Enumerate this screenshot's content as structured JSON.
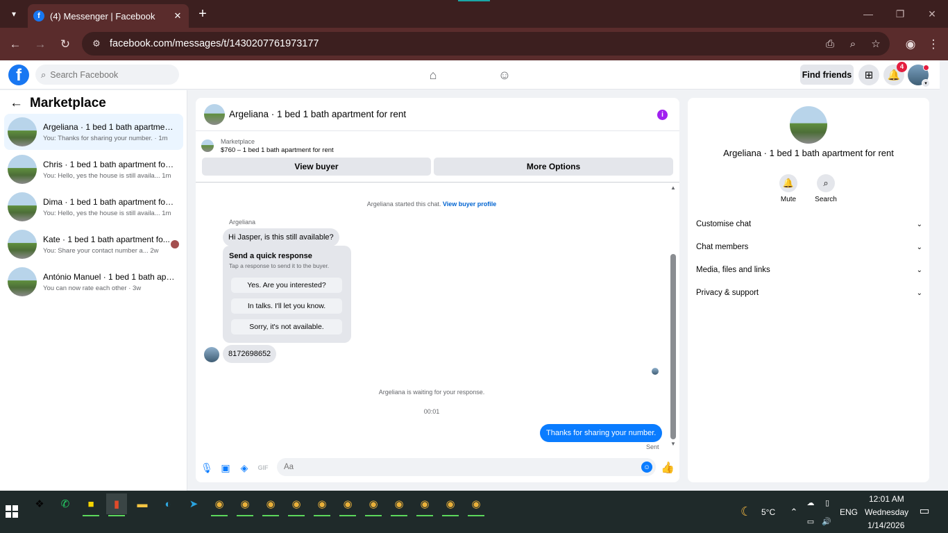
{
  "browser": {
    "tab_title": "(4) Messenger | Facebook",
    "url": "facebook.com/messages/t/1430207761973177"
  },
  "fb_header": {
    "search_placeholder": "Search Facebook",
    "find_friends": "Find friends",
    "notification_count": "4"
  },
  "sidebar": {
    "title": "Marketplace",
    "conversations": [
      {
        "name": "Argeliana · 1 bed 1 bath apartment...",
        "snippet": "You: Thanks for sharing your number. · 1m"
      },
      {
        "name": "Chris · 1 bed 1 bath apartment for ...",
        "snippet": "You: Hello, yes the house is still availa... 1m"
      },
      {
        "name": "Dima · 1 bed 1 bath apartment for ...",
        "snippet": "You: Hello, yes the house is still availa... 1m"
      },
      {
        "name": "Kate · 1 bed 1 bath apartment fo...",
        "snippet": "You: Share your contact number a...  2w"
      },
      {
        "name": "António Manuel · 1 bed 1 bath apa...",
        "snippet": "You can now rate each other · 3w"
      }
    ]
  },
  "chat": {
    "title": "Argeliana · 1 bed 1 bath apartment for rent",
    "listing_category": "Marketplace",
    "listing_title": "$760 – 1 bed 1 bath apartment for rent",
    "view_buyer": "View buyer",
    "more_options": "More Options",
    "started_text": "Argeliana started this chat.",
    "view_profile_link": "View buyer profile",
    "sender_label": "Argeliana",
    "first_message": "Hi Jasper, is this still available?",
    "quick_response_title": "Send a quick response",
    "quick_response_sub": "Tap a response to send it to the buyer.",
    "quick_responses": [
      "Yes. Are you interested?",
      "In talks. I'll let you know.",
      "Sorry, it's not available."
    ],
    "phone_message": "8172698652",
    "waiting_text": "Argeliana is waiting for your response.",
    "time_text": "00:01",
    "outgoing_message": "Thanks for sharing your number.",
    "sent_label": "Sent",
    "composer_placeholder": "Aa"
  },
  "details": {
    "name": "Argeliana · 1 bed 1 bath apartment for rent",
    "mute": "Mute",
    "search": "Search",
    "sections": [
      "Customise chat",
      "Chat members",
      "Media, files and links",
      "Privacy & support"
    ]
  },
  "taskbar": {
    "weather": "5°C",
    "lang": "ENG",
    "time": "12:01 AM",
    "day": "Wednesday",
    "date": "1/14/2026"
  },
  "colors": {
    "messenger_blue": "#0a7cff",
    "fb_blue": "#1877f2",
    "info_purple": "#a020f0",
    "browser_frame": "#5a2c2c"
  }
}
